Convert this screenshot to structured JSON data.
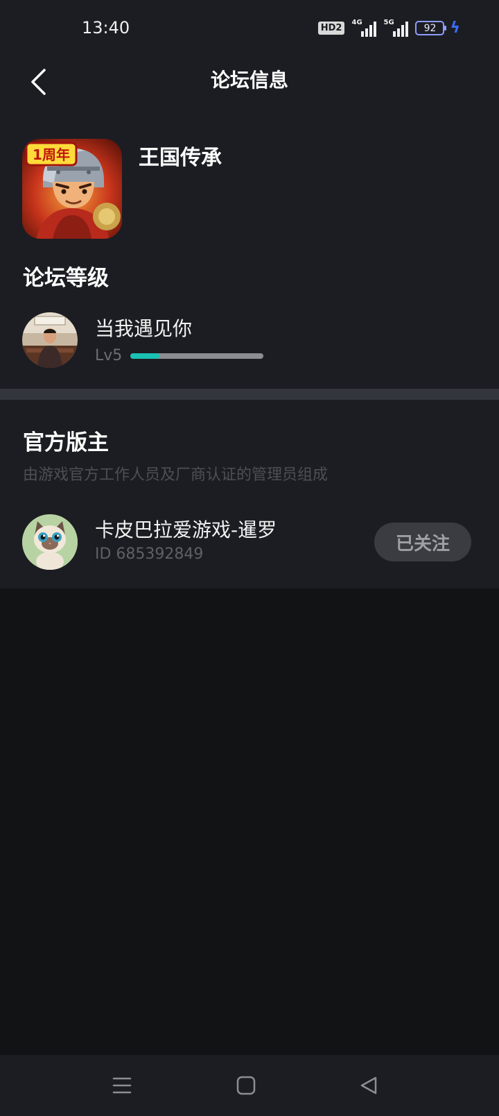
{
  "status_bar": {
    "time": "13:40",
    "hd_label": "HD2",
    "net1": "4G",
    "net2": "5G",
    "battery": "92",
    "icons": [
      "hd-icon",
      "signal-4g-icon",
      "signal-5g-icon",
      "battery-icon",
      "charging-bolt-icon"
    ]
  },
  "nav": {
    "title": "论坛信息",
    "back_icon": "chevron-left-icon"
  },
  "forum": {
    "game_name": "王国传承",
    "game_icon_badge": "1周年",
    "level_heading": "论坛等级",
    "user": {
      "name": "当我遇见你",
      "level": "Lv5",
      "progress": 0.22
    }
  },
  "moderators": {
    "heading": "官方版主",
    "description": "由游戏官方工作人员及厂商认证的管理员组成",
    "items": [
      {
        "name": "卡皮巴拉爱游戏-暹罗",
        "id": "ID 685392849",
        "follow_label": "已关注"
      }
    ]
  },
  "system_nav": {
    "icons": [
      "menu-icon",
      "home-square-icon",
      "back-triangle-icon"
    ]
  },
  "colors": {
    "background": "#1c1d22",
    "empty_area": "#121314",
    "divider": "#33363c",
    "accent": "#19c2b2"
  }
}
